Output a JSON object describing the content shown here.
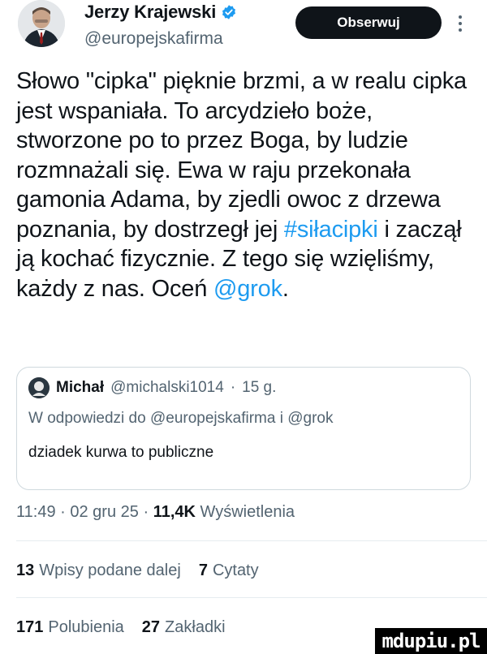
{
  "author": {
    "name": "Jerzy Krajewski",
    "handle": "@europejskafirma",
    "follow_label": "Obserwuj"
  },
  "tweet": {
    "text_parts": {
      "p1": "Słowo \"cipka\" pięknie brzmi, a w realu cipka jest wspaniała. To arcydzieło boże, stworzone po to przez Boga, by ludzie rozmnażali się. Ewa w raju przekonała gamonia Adama, by zjedli owoc z drzewa poznania, by dostrzegł jej ",
      "hashtag": "#siłacipki",
      "p2": " i zaczął ją kochać fizycznie. Z tego się wzięliśmy, każdy z nas. Oceń ",
      "mention": "@grok",
      "p3": "."
    }
  },
  "quote": {
    "name": "Michał",
    "handle": "@michalski1014",
    "separator": "·",
    "age": "15 g.",
    "reply_prefix": "W odpowiedzi do",
    "reply_user1": "@europejskafirma",
    "reply_and": "i",
    "reply_user2": "@grok",
    "body": "dziadek kurwa to publiczne"
  },
  "meta": {
    "time": "11:49",
    "sep": "·",
    "date": "02 gru 25",
    "views_count": "11,4K",
    "views_label": "Wyświetlenia"
  },
  "stats": {
    "reposts_count": "13",
    "reposts_label": "Wpisy podane dalej",
    "quotes_count": "7",
    "quotes_label": "Cytaty",
    "likes_count": "171",
    "likes_label": "Polubienia",
    "bookmarks_count": "27",
    "bookmarks_label": "Zakładki"
  },
  "watermark": "mdupiu.pl",
  "colors": {
    "accent": "#1d9bf0",
    "text": "#0f1419",
    "secondary": "#536471",
    "border": "#cfd9de"
  },
  "icons": [
    "verified-badge-icon",
    "more-options-icon"
  ]
}
